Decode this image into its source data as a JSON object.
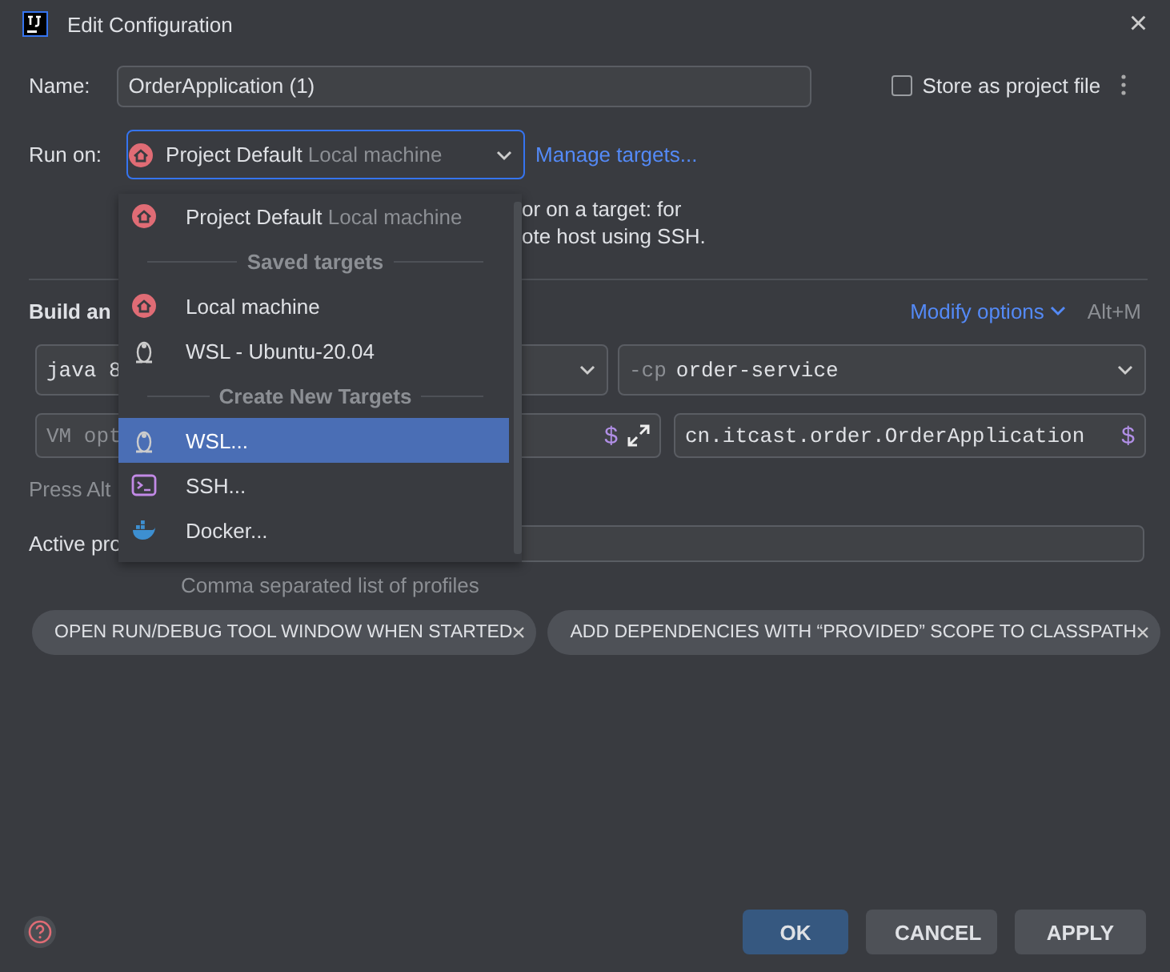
{
  "window": {
    "title": "Edit Configuration",
    "close": "×"
  },
  "name_row": {
    "label": "Name:",
    "value": "OrderApplication (1)",
    "store": {
      "label": "Store as project file",
      "checked": false
    }
  },
  "run_on": {
    "label": "Run on:",
    "value": "Project Default",
    "hint": "Local machine",
    "link": "Manage targets..."
  },
  "description": [
    "or on a target: for",
    "ote host using SSH."
  ],
  "build": {
    "heading": "Build an",
    "modify": "Modify options",
    "shortcut": "Alt+M"
  },
  "fields": {
    "jre": "java 8",
    "classpath_prefix": "-cp",
    "classpath": "order-service",
    "vm_placeholder": "VM opt",
    "main_class": "cn.itcast.order.OrderApplication",
    "dollar": "$"
  },
  "press_hint": "Press Alt",
  "active_profiles": {
    "label": "Active pro",
    "hint": "Comma separated list of profiles"
  },
  "chips": [
    {
      "label": "OPEN RUN/DEBUG TOOL WINDOW WHEN STARTED"
    },
    {
      "label": "ADD DEPENDENCIES WITH “PROVIDED” SCOPE TO CLASSPATH"
    }
  ],
  "popup": [
    {
      "kind": "local",
      "label": "Project Default",
      "hint": "Local machine",
      "selected": false
    },
    {
      "kind": "header",
      "label": "Saved targets"
    },
    {
      "kind": "local",
      "label": "Local machine",
      "selected": false
    },
    {
      "kind": "wsl",
      "label": "WSL - Ubuntu-20.04",
      "selected": false
    },
    {
      "kind": "header",
      "label": "Create New Targets"
    },
    {
      "kind": "wsl",
      "label": "WSL...",
      "selected": true
    },
    {
      "kind": "ssh",
      "label": "SSH...",
      "selected": false
    },
    {
      "kind": "docker",
      "label": "Docker...",
      "selected": false
    }
  ],
  "buttons": [
    {
      "label": "OK",
      "kind": "primary"
    },
    {
      "label": "CANCEL",
      "kind": "normal"
    },
    {
      "label": "APPLY",
      "kind": "normal"
    }
  ]
}
